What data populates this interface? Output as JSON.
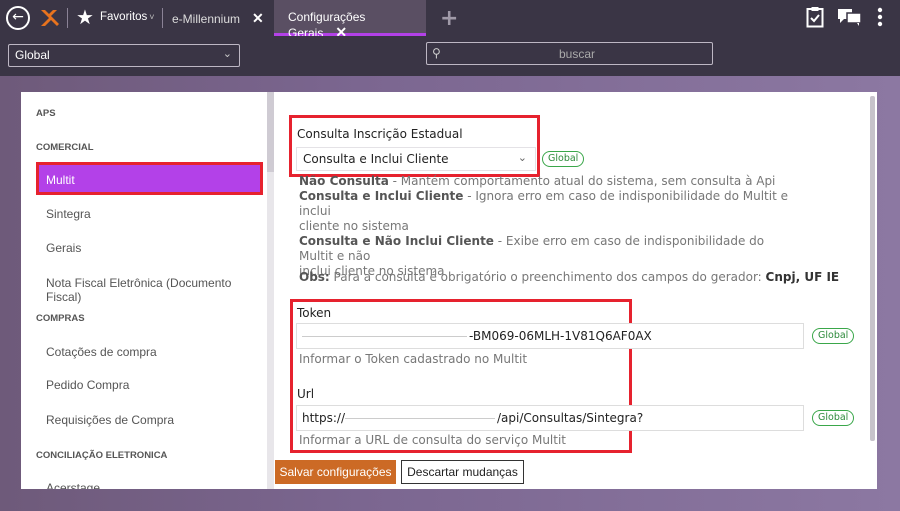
{
  "topbar": {
    "favorites_label": "Favoritos",
    "tabs": [
      {
        "label": "e-Millennium"
      },
      {
        "label": "Configurações Gerais"
      }
    ]
  },
  "filter": {
    "scope_value": "Global",
    "search_placeholder": "buscar"
  },
  "sidebar": {
    "sections": [
      {
        "label": "APS"
      },
      {
        "label": "COMERCIAL"
      },
      {
        "label": "COMPRAS"
      },
      {
        "label": "CONCILIAÇÃO ELETRONICA"
      }
    ],
    "items": [
      {
        "label": "Multit"
      },
      {
        "label": "Sintegra"
      },
      {
        "label": "Gerais"
      },
      {
        "label": "Nota Fiscal Eletrônica (Documento Fiscal)"
      },
      {
        "label": "Cotações de compra"
      },
      {
        "label": "Pedido Compra"
      },
      {
        "label": "Requisições de Compra"
      },
      {
        "label": "Acerstage"
      }
    ]
  },
  "main": {
    "consulta_label": "Consulta Inscrição Estadual",
    "consulta_value": "Consulta e Inclui Cliente",
    "global_badge": "Global",
    "desc": [
      {
        "b": "Não Consulta",
        "t": " - Mantém comportamento atual do sistema, sem consulta à Api"
      },
      {
        "b": "Consulta e Inclui Cliente",
        "t": " - Ignora erro em caso de indisponibilidade do Multit e inclui"
      },
      {
        "t": "cliente no sistema"
      },
      {
        "b": "Consulta e Não Inclui Cliente",
        "t": " - Exibe erro em caso de indisponibilidade do Multit e não"
      },
      {
        "t": "inclui cliente no sistema"
      }
    ],
    "obs_b": "Obs:",
    "obs_t": " Para a consulta é obrigatório o preenchimento dos campos do gerador: ",
    "obs_fields": "Cnpj, UF IE",
    "token_label": "Token",
    "token_value": "-BM069-06MLH-1V81Q6AF0AX",
    "token_hint": "Informar o Token cadastrado no Multit",
    "url_label": "Url",
    "url_prefix": "https://",
    "url_suffix": "/api/Consultas/Sintegra?",
    "url_hint": "Informar a URL de consulta do serviço Multit"
  },
  "actions": {
    "save": "Salvar configurações",
    "discard": "Descartar mudanças"
  },
  "colors": {
    "accent": "#b341e8",
    "highlight": "#e6222e",
    "save_button": "#cc6a25",
    "global_badge": "#3aa74a"
  }
}
